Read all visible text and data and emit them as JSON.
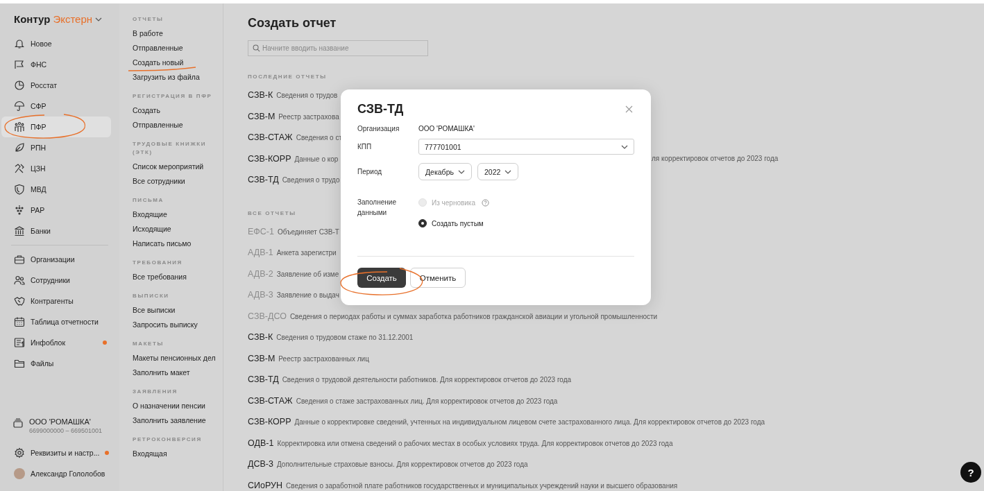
{
  "sidebar": {
    "logo": {
      "first": "Контур",
      "second": "Экстерн"
    },
    "items": [
      {
        "label": "Новое",
        "selected": false,
        "dot": false
      },
      {
        "label": "ФНС",
        "selected": false,
        "dot": false
      },
      {
        "label": "Росстат",
        "selected": false,
        "dot": false
      },
      {
        "label": "СФР",
        "selected": false,
        "dot": false
      },
      {
        "label": "ПФР",
        "selected": true,
        "dot": false
      },
      {
        "label": "РПН",
        "selected": false,
        "dot": false
      },
      {
        "label": "ЦЗН",
        "selected": false,
        "dot": false
      },
      {
        "label": "МВД",
        "selected": false,
        "dot": false
      },
      {
        "label": "РАР",
        "selected": false,
        "dot": false
      },
      {
        "label": "Банки",
        "selected": false,
        "dot": false
      }
    ],
    "tools": [
      {
        "label": "Организации",
        "selected": false,
        "dot": false
      },
      {
        "label": "Сотрудники",
        "selected": false,
        "dot": false
      },
      {
        "label": "Контрагенты",
        "selected": false,
        "dot": false
      },
      {
        "label": "Таблица отчетности",
        "selected": false,
        "dot": false
      },
      {
        "label": "Инфоблок",
        "selected": false,
        "dot": true
      },
      {
        "label": "Файлы",
        "selected": false,
        "dot": false
      }
    ],
    "organization": {
      "name": "ООО 'РОМАШКА'",
      "codes": "6699000000 – 669501001"
    },
    "settings": {
      "label": "Реквизиты и настр...",
      "dot": true
    },
    "user": {
      "name": "Александр Гололобов"
    }
  },
  "subnav": {
    "sections": [
      {
        "title": "ОТЧЕТЫ",
        "items": [
          "В работе",
          "Отправленные",
          "Создать новый",
          "Загрузить из файла"
        ]
      },
      {
        "title": "РЕГИСТРАЦИЯ В ПФР",
        "items": [
          "Создать",
          "Отправленные"
        ]
      },
      {
        "title": "ТРУДОВЫЕ КНИЖКИ (ЭТК)",
        "items": [
          "Список мероприятий",
          "Все сотрудники"
        ]
      },
      {
        "title": "ПИСЬМА",
        "items": [
          "Входящие",
          "Исходящие",
          "Написать письмо"
        ]
      },
      {
        "title": "ТРЕБОВАНИЯ",
        "items": [
          "Все требования"
        ]
      },
      {
        "title": "ВЫПИСКИ",
        "items": [
          "Все выписки",
          "Запросить выписку"
        ]
      },
      {
        "title": "МАКЕТЫ",
        "items": [
          "Макеты пенсионных дел",
          "Заполнить макет"
        ]
      },
      {
        "title": "ЗАЯВЛЕНИЯ",
        "items": [
          "О назначении пенсии",
          "Заполнить заявление"
        ]
      },
      {
        "title": "РЕТРОКОНВЕРСИЯ",
        "items": [
          "Входящая"
        ]
      }
    ]
  },
  "main": {
    "title": "Создать отчет",
    "search": {
      "placeholder": "Начните вводить название"
    },
    "recent": {
      "title": "ПОСЛЕДНИЕ ОТЧЕТЫ",
      "rows": [
        {
          "code": "СЗВ-К",
          "description": "Сведения о трудов"
        },
        {
          "code": "СЗВ-М",
          "description": "Реестр застрахова"
        },
        {
          "code": "СЗВ-СТАЖ",
          "description": "Сведения о ст"
        },
        {
          "code": "СЗВ-КОРР",
          "description": "Данные о кор",
          "tail": "ля корректировок отчетов до 2023 года"
        },
        {
          "code": "СЗВ-ТД",
          "description": "Сведения о трудо"
        }
      ]
    },
    "all": {
      "title": "ВСЕ ОТЧЕТЫ",
      "rows": [
        {
          "code": "ЕФС-1",
          "description": "Объединяет СЗВ-Т",
          "disabled": true
        },
        {
          "code": "АДВ-1",
          "description": "Анкета зарегистри",
          "disabled": true
        },
        {
          "code": "АДВ-2",
          "description": "Заявление об изме",
          "disabled": true
        },
        {
          "code": "АДВ-3",
          "description": "Заявление о выдач",
          "disabled": true
        },
        {
          "code": "СЗВ-ДСО",
          "description": "Сведения о периодах работы и суммах заработка работников гражданской авиации и угольной промышленности",
          "disabled": true
        },
        {
          "code": "СЗВ-К",
          "description": "Сведения о трудовом стаже по 31.12.2001",
          "disabled": false
        },
        {
          "code": "СЗВ-М",
          "description": "Реестр застрахованных лиц",
          "disabled": false
        },
        {
          "code": "СЗВ-ТД",
          "description": "Сведения о трудовой деятельности работников. Для корректировок отчетов до 2023 года",
          "disabled": false
        },
        {
          "code": "СЗВ-СТАЖ",
          "description": "Сведения о стаже застрахованных лиц. Для корректировок отчетов до 2023 года",
          "disabled": false
        },
        {
          "code": "СЗВ-КОРР",
          "description": "Данные о корректировке сведений, учтенных на индивидуальном лицевом счете застрахованного лица. Для корректировок отчетов до 2023 года",
          "disabled": false
        },
        {
          "code": "ОДВ-1",
          "description": "Корректировка или отмена сведений о рабочих местах в особых условиях труда. Для корректировок отчетов до 2023 года",
          "disabled": false
        },
        {
          "code": "ДСВ-3",
          "description": "Дополнительные страховые взносы. Для корректировок отчетов до 2023 года",
          "disabled": false
        },
        {
          "code": "СИоРУН",
          "description": "Сведения о заработной плате работников государственных и муниципальных учреждений науки и высшего образования",
          "disabled": false
        }
      ]
    }
  },
  "dialog": {
    "title": "СЗВ-ТД",
    "organization": {
      "label": "Организация",
      "value": "ООО 'РОМАШКА'"
    },
    "kpp": {
      "label": "КПП",
      "value": "777701001"
    },
    "period": {
      "label": "Период",
      "month": "Декабрь",
      "year": "2022"
    },
    "filling": {
      "label": "Заполнение данными",
      "options": [
        {
          "label": "Из черновика",
          "selected": false,
          "disabled": true,
          "help": true
        },
        {
          "label": "Создать пустым",
          "selected": true,
          "disabled": false,
          "help": false
        }
      ]
    },
    "buttons": {
      "primary": "Создать",
      "secondary": "Отменить"
    }
  },
  "help_button": {
    "label": "?"
  }
}
